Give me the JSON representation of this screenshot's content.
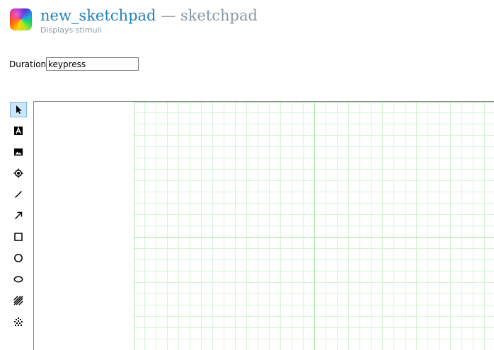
{
  "header": {
    "item_name": "new_sketchpad",
    "separator": "—",
    "item_type": "sketchpad",
    "description": "Displays stimuli"
  },
  "duration": {
    "label": "Duration",
    "value": "keypress"
  },
  "toolbar": {
    "tools": [
      {
        "name": "select",
        "icon": "cursor-arrow-icon",
        "active": true
      },
      {
        "name": "text",
        "icon": "text-icon",
        "active": false
      },
      {
        "name": "image",
        "icon": "image-icon",
        "active": false
      },
      {
        "name": "fixation-dot",
        "icon": "fixdot-icon",
        "active": false
      },
      {
        "name": "line",
        "icon": "line-icon",
        "active": false
      },
      {
        "name": "arrow",
        "icon": "arrow-icon",
        "active": false
      },
      {
        "name": "rectangle",
        "icon": "rectangle-icon",
        "active": false
      },
      {
        "name": "circle",
        "icon": "circle-icon",
        "active": false
      },
      {
        "name": "ellipse",
        "icon": "ellipse-icon",
        "active": false
      },
      {
        "name": "gabor",
        "icon": "gabor-icon",
        "active": false
      },
      {
        "name": "noise-patch",
        "icon": "noise-patch-icon",
        "active": false
      }
    ]
  },
  "canvas": {
    "grid_color": "#d6f5d6",
    "axis_color": "#a8e6a8",
    "background": "#ffffff"
  }
}
